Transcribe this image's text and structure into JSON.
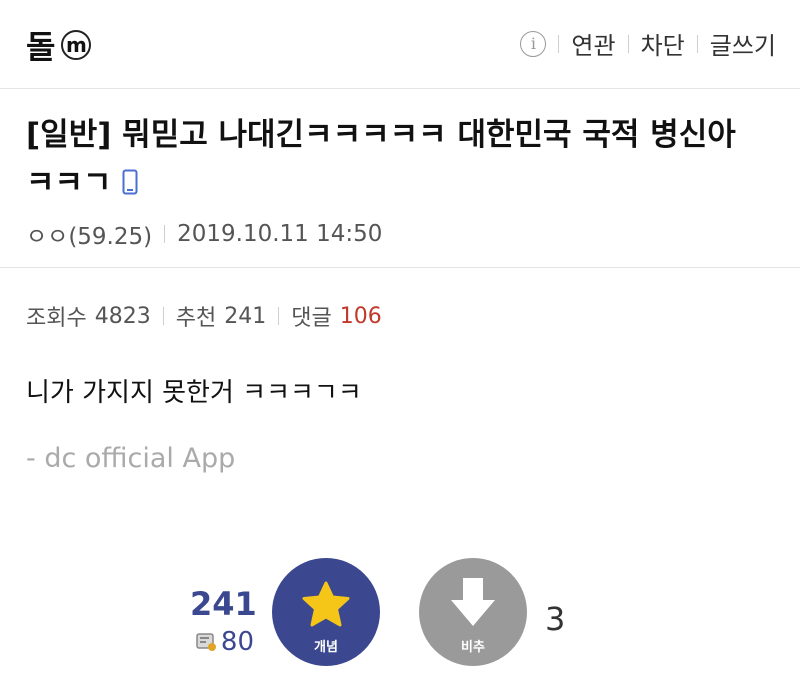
{
  "header": {
    "gallery_title": "돌",
    "minor_badge": "m",
    "info_icon": "i",
    "links": [
      "연관",
      "차단",
      "글쓰기"
    ]
  },
  "post": {
    "title": "[일반] 뭐믿고 나대긴ㅋㅋㅋㅋㅋ 대한민국 국적 병신아 ㅋㅋㄱ",
    "device_icon": "mobile-phone-icon",
    "author": "ㅇㅇ(59.25)",
    "datetime": "2019.10.11 14:50",
    "stats": {
      "views_label": "조회수",
      "views": "4823",
      "recommend_label": "추천",
      "recommend": "241",
      "comments_label": "댓글",
      "comments": "106"
    },
    "body": "니가 가지지 못한거 ㅋㅋㅋㄱㅋ",
    "signature": "- dc official App"
  },
  "vote": {
    "up_count": "241",
    "fixed_count": "80",
    "up_label": "개념",
    "down_label": "비추",
    "down_count": "3"
  },
  "colors": {
    "accent": "#3b4890",
    "comment_count": "#c0392b",
    "down_button": "#9a9a9a"
  }
}
